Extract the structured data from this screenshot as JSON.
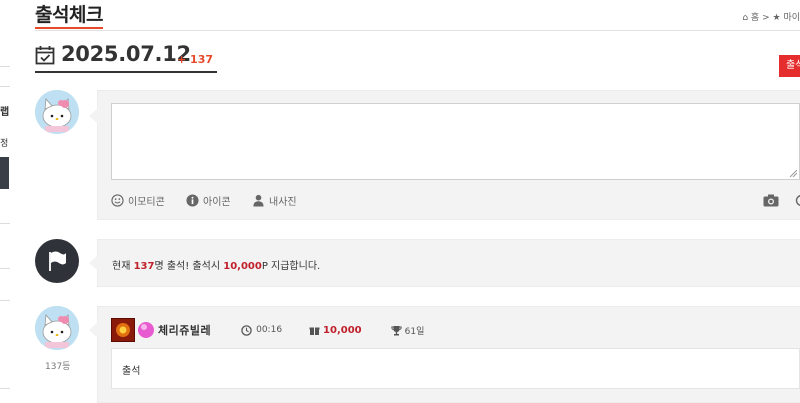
{
  "sidebar": {
    "cut_label_1": "랩",
    "cut_label_2": "정"
  },
  "header": {
    "title": "출석체크",
    "breadcrumb": {
      "home": "홈",
      "separator": ">",
      "current": "마이"
    }
  },
  "date_row": {
    "date": "2025.07.12",
    "count": "+ 137",
    "checkin_button": "출석"
  },
  "composer": {
    "textarea_value": "",
    "tools": {
      "emoticon": "이모티콘",
      "icon": "아이콘",
      "my_photo": "내사진"
    }
  },
  "notice": {
    "prefix": "현재",
    "count": "137",
    "middle": "명 출석! 출석시",
    "points": "10,000",
    "suffix": "P 지급합니다."
  },
  "entries": [
    {
      "rank": "137등",
      "nickname": "체리쥬빌레",
      "time": "00:16",
      "points": "10,000",
      "days": "61일",
      "message": "출석"
    }
  ],
  "colors": {
    "accent": "#e64a2a",
    "button": "#e62d2d",
    "points_red": "#c0202b"
  }
}
